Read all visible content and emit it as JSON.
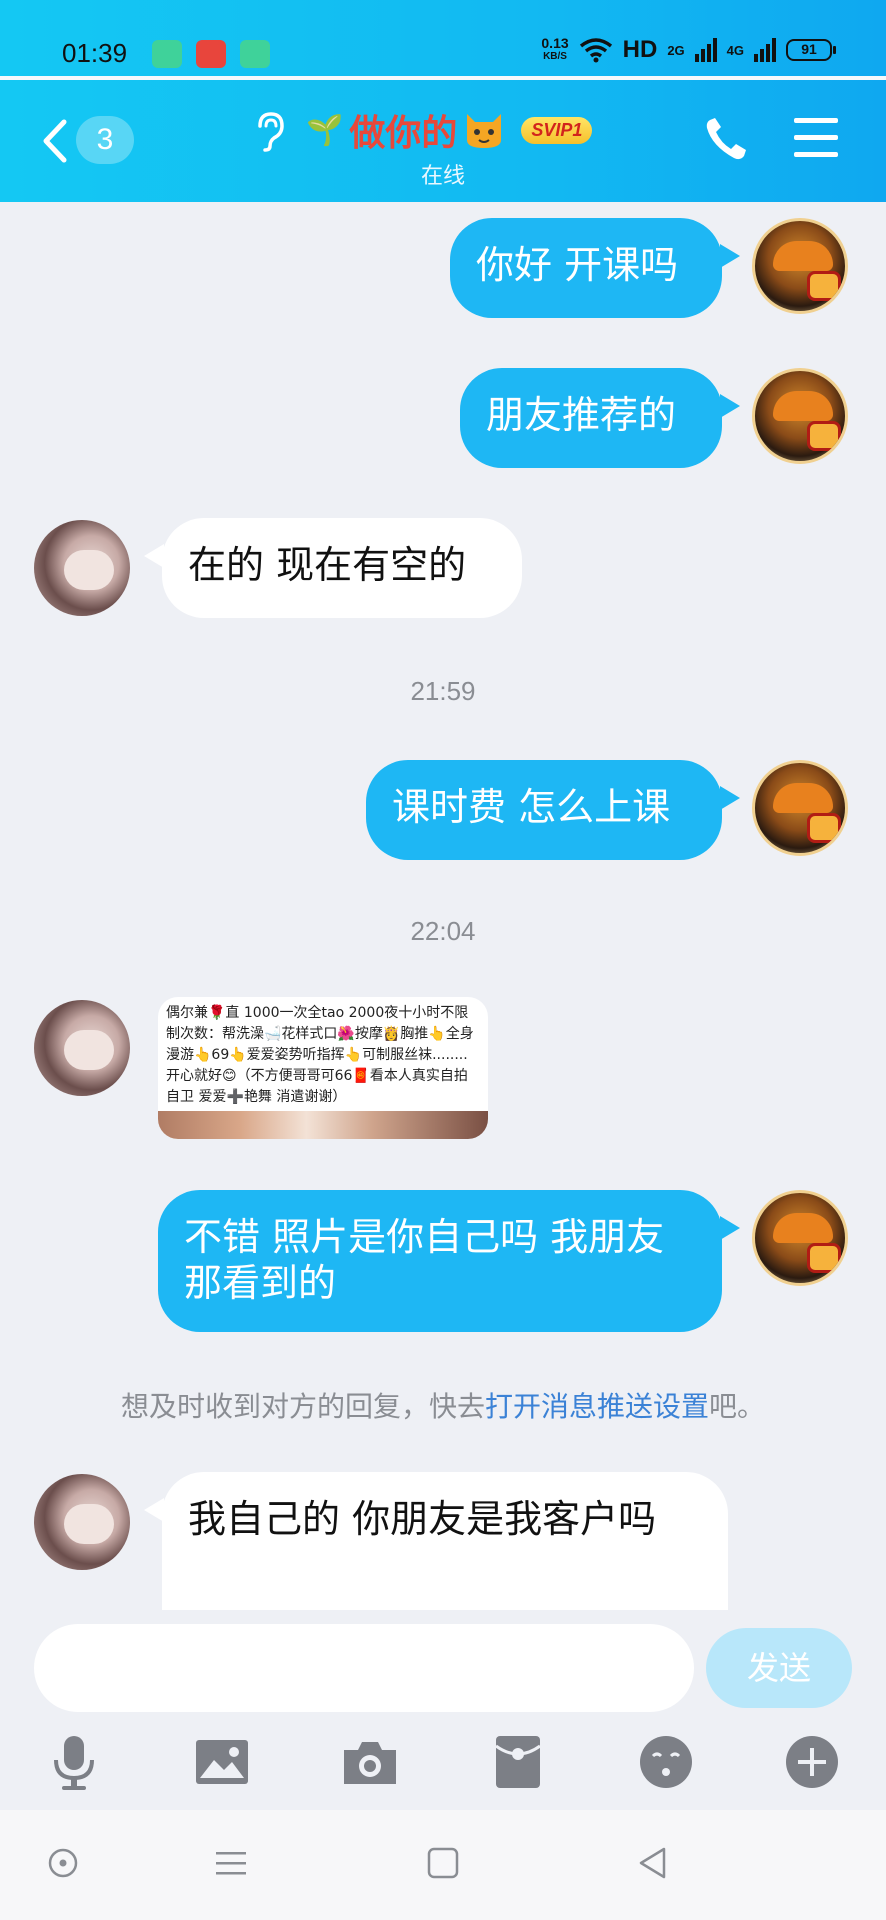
{
  "status_bar": {
    "time": "01:39",
    "net_speed": "0.13",
    "net_unit": "KB/S",
    "hd": "HD",
    "net2g": "2G",
    "net4g": "4G",
    "battery": "91"
  },
  "header": {
    "unread_count": "3",
    "contact_name": "做你的",
    "vip_badge": "SVIP1",
    "status": "在线",
    "accent": "#12b9f2",
    "name_color": "#e8483a"
  },
  "messages": [
    {
      "from": "me",
      "text": "你好 开课吗"
    },
    {
      "from": "me",
      "text": "朋友推荐的"
    },
    {
      "from": "her",
      "text": "在的 现在有空的"
    },
    {
      "timestamp": "21:59"
    },
    {
      "from": "me",
      "text": "课时费 怎么上课"
    },
    {
      "timestamp": "22:04"
    },
    {
      "from": "her",
      "type": "image",
      "image_text": "偶尔兼🌹直 1000一次全tao 2000夜十小时不限制次数：帮洗澡🛁花样式口🌺按摩👸胸推👆全身漫游👆69👆爱爱姿势听指挥👆可制服丝袜........开心就好😊（不方便哥哥可66🧧看本人真实自拍 自卫 爱爱➕艳舞 消遣谢谢）"
    },
    {
      "from": "me",
      "text": "不错 照片是你自己吗 我朋友那看到的"
    },
    {
      "system_tip": "想及时收到对方的回复，快去",
      "system_link": "打开消息推送设置",
      "system_tail": "吧。"
    },
    {
      "from": "her",
      "text": "我自己的  你朋友是我客户吗"
    }
  ],
  "input": {
    "placeholder": "",
    "send_label": "发送"
  },
  "toolbar_icons": [
    "microphone-icon",
    "image-icon",
    "camera-icon",
    "red-packet-icon",
    "emoji-icon",
    "plus-icon"
  ]
}
